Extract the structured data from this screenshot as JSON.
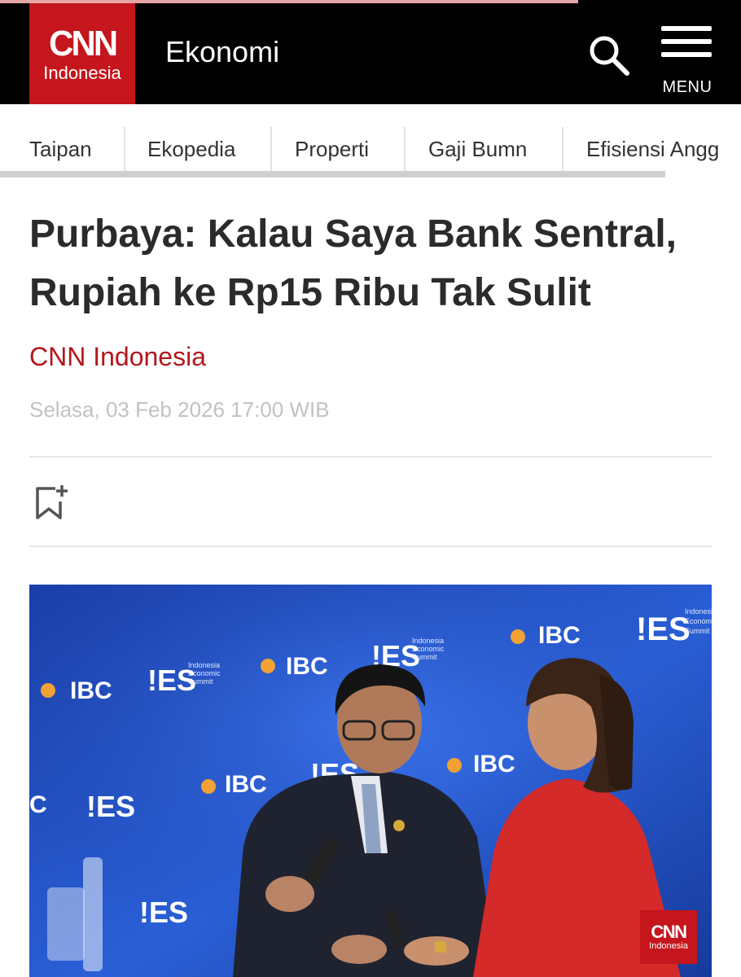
{
  "header": {
    "logo_main": "CNN",
    "logo_sub": "Indonesia",
    "section": "Ekonomi",
    "menu_label": "MENU",
    "colors": {
      "bar": "#000000",
      "brand": "#c4161c"
    }
  },
  "nav": {
    "items": [
      {
        "label": "Taipan"
      },
      {
        "label": "Ekopedia"
      },
      {
        "label": "Properti"
      },
      {
        "label": "Gaji Bumn"
      },
      {
        "label": "Efisiensi Angg"
      }
    ]
  },
  "article": {
    "title": "Purbaya: Kalau Saya Bank Sentral, Rupiah ke Rp15 Ribu Tak Sulit",
    "author": "CNN Indonesia",
    "date": "Selasa, 03 Feb 2026 17:00 WIB",
    "bookmark_icon": "bookmark-add-icon"
  },
  "photo": {
    "backdrop_logos": [
      "IBC",
      "IES",
      "Indonesia Economic Summit"
    ],
    "watermark_main": "CNN",
    "watermark_sub": "Indonesia"
  }
}
